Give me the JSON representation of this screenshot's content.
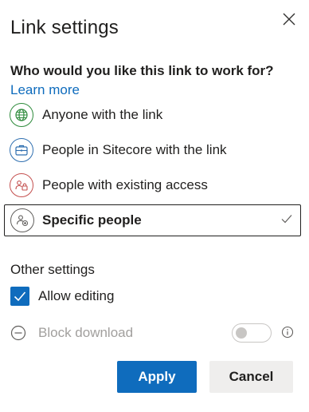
{
  "dialog": {
    "title": "Link settings",
    "close_icon": "close-icon"
  },
  "audience": {
    "question": "Who would you like this link to work for?",
    "learn_more": "Learn more",
    "options": [
      {
        "label": "Anyone with the link",
        "icon": "globe-icon",
        "color": "#2e8b3c",
        "selected": false
      },
      {
        "label": "People in Sitecore with the link",
        "icon": "briefcase-icon",
        "color": "#2f6fb0",
        "selected": false
      },
      {
        "label": "People with existing access",
        "icon": "people-lock-icon",
        "color": "#c4504f",
        "selected": false
      },
      {
        "label": "Specific people",
        "icon": "people-add-icon",
        "color": "#605e5c",
        "selected": true
      }
    ]
  },
  "other_settings": {
    "title": "Other settings",
    "allow_editing": {
      "label": "Allow editing",
      "checked": true
    },
    "block_download": {
      "label": "Block download",
      "enabled": false,
      "toggle_on": false
    }
  },
  "buttons": {
    "apply": "Apply",
    "cancel": "Cancel"
  },
  "colors": {
    "accent": "#0f6cbd",
    "text": "#201f1e",
    "disabled": "#a19f9d"
  }
}
